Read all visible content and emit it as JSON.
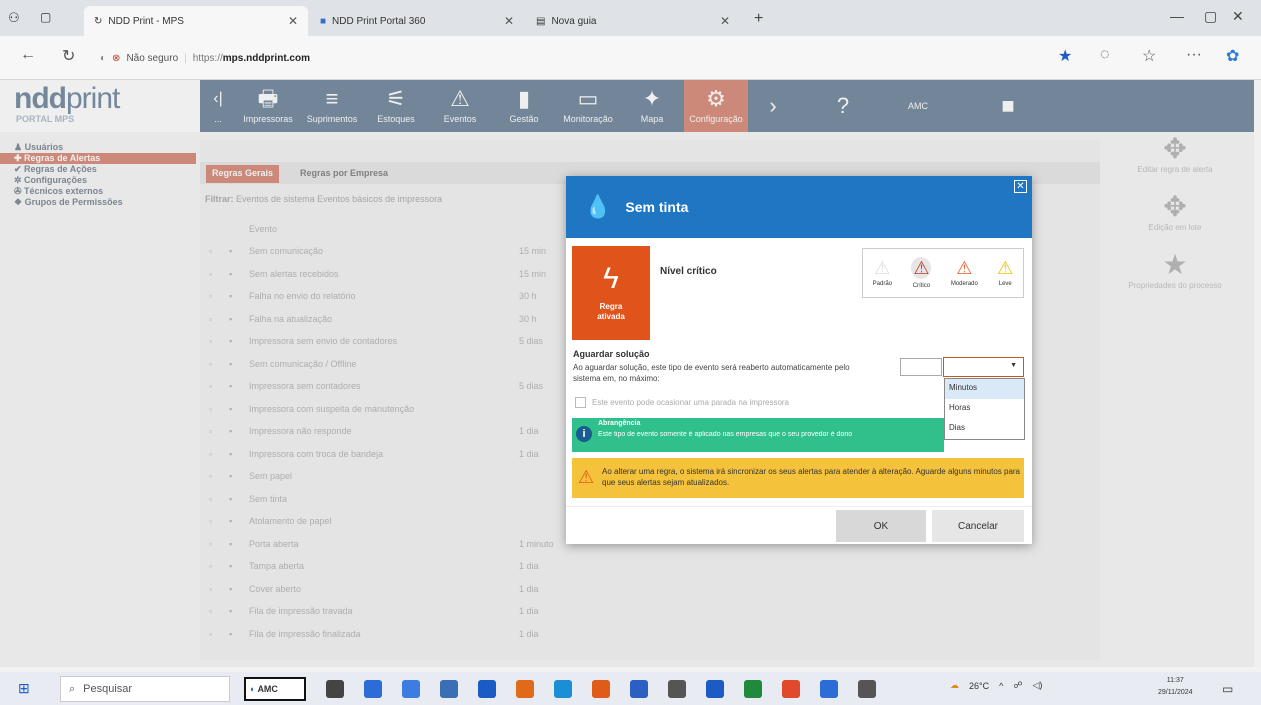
{
  "browser": {
    "tabs": [
      {
        "label": "NDD Print - MPS",
        "active": true
      },
      {
        "label": "NDD Print Portal 360",
        "active": false
      },
      {
        "label": "Nova guia",
        "active": false
      }
    ],
    "new_tab": "+",
    "security_label": "Não seguro",
    "url_prefix": "https://",
    "url_host": "mps.nddprint.com"
  },
  "app": {
    "logo_bold": "ndd",
    "logo_light": "print",
    "portal": "PORTAL MPS",
    "nav": [
      {
        "icon": "‹|",
        "label": "...",
        "color": "#1e3f63"
      },
      {
        "icon": "🖶",
        "label": "Impressoras"
      },
      {
        "icon": "≡",
        "label": "Suprimentos"
      },
      {
        "icon": "⚟",
        "label": "Estoques"
      },
      {
        "icon": "⚠",
        "label": "Eventos"
      },
      {
        "icon": "▮",
        "label": "Gestão"
      },
      {
        "icon": "▭",
        "label": "Monitoração"
      },
      {
        "icon": "✦",
        "label": "Mapa"
      },
      {
        "icon": "⚙",
        "label": "Configuração"
      },
      {
        "icon": "›",
        "label": ""
      },
      {
        "icon": "?",
        "label": ""
      },
      {
        "icon": "",
        "label": "AMC"
      },
      {
        "icon": "■",
        "label": ""
      }
    ]
  },
  "sidebar": {
    "items": [
      {
        "label": "Usuários",
        "active": false
      },
      {
        "label": "Regras de Alertas",
        "active": true
      },
      {
        "label": "Regras de Ações",
        "active": false
      },
      {
        "label": "Configurações",
        "active": false
      },
      {
        "label": "Técnicos externos",
        "active": false
      },
      {
        "label": "Grupos de Permissões",
        "active": false
      }
    ]
  },
  "content": {
    "tabs": [
      "Regras Gerais",
      "Regras por Empresa"
    ],
    "filter_label": "Filtrar:",
    "filter_text": "Eventos de sistema  Eventos básicos de impressora",
    "column_header": "Evento",
    "rows": [
      {
        "name": "Sem comunicação",
        "value": "15 min"
      },
      {
        "name": "Sem alertas recebidos",
        "value": "15 min"
      },
      {
        "name": "Falha no envio do relatório",
        "value": "30 h"
      },
      {
        "name": "Falha na atualização",
        "value": "30 h"
      },
      {
        "name": "Impressora sem envio de contadores",
        "value": "5 dias"
      },
      {
        "name": "Sem comunicação / Offline",
        "value": ""
      },
      {
        "name": "Impressora sem contadores",
        "value": "5 dias"
      },
      {
        "name": "Impressora com suspeita de manutenção",
        "value": ""
      },
      {
        "name": "Impressora não responde",
        "value": "1 dia"
      },
      {
        "name": "Impressora com troca de bandeja",
        "value": "1 dia"
      },
      {
        "name": "Sem papel",
        "value": ""
      },
      {
        "name": "Sem tinta",
        "value": ""
      },
      {
        "name": "Atolamento de papel",
        "value": ""
      },
      {
        "name": "Porta aberta",
        "value": "1 minuto"
      },
      {
        "name": "Tampa aberta",
        "value": "1 dia"
      },
      {
        "name": "Cover aberto",
        "value": "1 dia"
      },
      {
        "name": "Fila de impressão travada",
        "value": "1 dia"
      },
      {
        "name": "Fila de impressão finalizada",
        "value": "1 dia"
      }
    ]
  },
  "right_panel": {
    "items": [
      {
        "icon": "✥",
        "label": "Editar regra de alerta"
      },
      {
        "icon": "✥",
        "label": "Edição em lote"
      },
      {
        "icon": "★",
        "label": "Propriedades do processo"
      }
    ]
  },
  "modal": {
    "title": "Sem tinta",
    "close": "✕",
    "rule_status": "Regra ativada",
    "level_label": "Nível crítico",
    "levels": [
      {
        "label": "Padrão",
        "color": "#dddddd"
      },
      {
        "label": "Crítico",
        "color": "#c0392b"
      },
      {
        "label": "Moderado",
        "color": "#e8612a"
      },
      {
        "label": "Leve",
        "color": "#f2c200"
      }
    ],
    "wait_title": "Aguardar solução",
    "wait_desc": "Ao aguardar solução, este tipo de evento será reaberto automaticamente pelo sistema em, no máximo:",
    "wait_value": "",
    "select_value": "",
    "options": [
      "Minutos",
      "Horas",
      "Dias"
    ],
    "selected_option": "Minutos",
    "checkbox_label": "Este evento pode ocasionar uma parada na impressora",
    "info_title": "Abrangência",
    "info_text": "Este tipo de evento somente é aplicado nas empresas que o seu provedor é dono",
    "warning_text": "Ao alterar uma regra, o sistema irá sincronizar os seus alertas para atender à alteração. Aguarde alguns minutos para que seus alertas sejam atualizados.",
    "ok": "OK",
    "cancel": "Cancelar"
  },
  "taskbar": {
    "search": "Pesquisar",
    "app_label": "AMC",
    "temperature": "26°C",
    "time": "11:37",
    "date": "29/11/2024"
  }
}
